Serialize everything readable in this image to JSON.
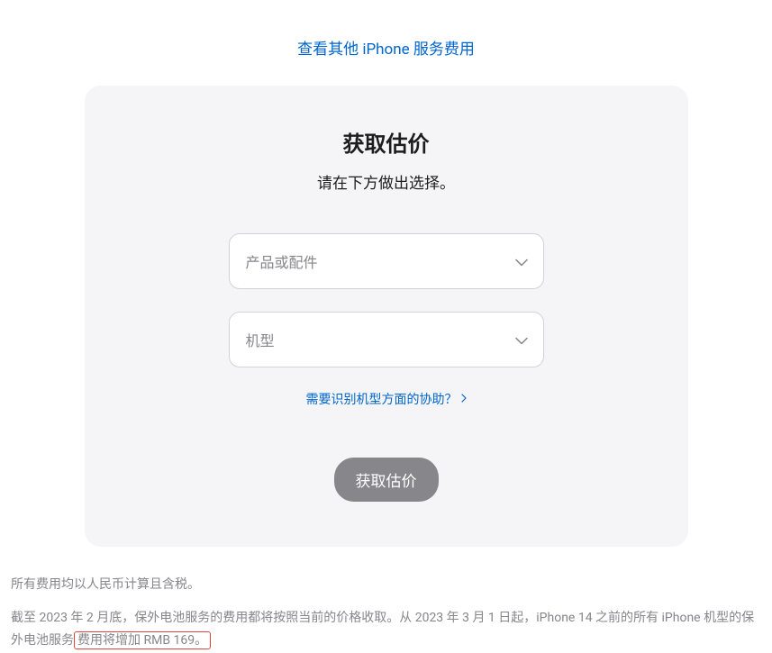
{
  "topLink": {
    "label": "查看其他 iPhone 服务费用"
  },
  "card": {
    "title": "获取估价",
    "subtitle": "请在下方做出选择。",
    "productSelect": {
      "placeholder": "产品或配件"
    },
    "modelSelect": {
      "placeholder": "机型"
    },
    "helpLink": {
      "label": "需要识别机型方面的协助？"
    },
    "button": {
      "label": "获取估价"
    }
  },
  "footer": {
    "line1": "所有费用均以人民币计算且含税。",
    "line2_prefix": "截至 2023 年 2 月底，保外电池服务的费用都将按照当前的价格收取。从 2023 年 3 月 1 日起，iPhone 14 之前的所有 iPhone 机型的保外电池服",
    "line2_highlight_prefix": "务",
    "line2_highlight": "费用将增加 RMB 169。"
  }
}
